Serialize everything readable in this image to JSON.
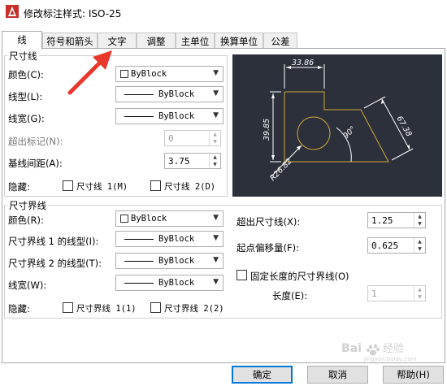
{
  "window": {
    "title": "修改标注样式: ISO-25"
  },
  "tabs": [
    {
      "label": "线",
      "active": true
    },
    {
      "label": "符号和箭头",
      "active": false
    },
    {
      "label": "文字",
      "active": false
    },
    {
      "label": "调整",
      "active": false
    },
    {
      "label": "主单位",
      "active": false
    },
    {
      "label": "换算单位",
      "active": false
    },
    {
      "label": "公差",
      "active": false
    }
  ],
  "dim_lines": {
    "group_label": "尺寸线",
    "color": {
      "label": "颜色(C):",
      "value": "ByBlock"
    },
    "linetype": {
      "label": "线型(L):",
      "value": "ByBlock"
    },
    "lineweight": {
      "label": "线宽(G):",
      "value": "ByBlock"
    },
    "extend_ticks": {
      "label": "超出标记(N):",
      "value": "0"
    },
    "baseline_spacing": {
      "label": "基线间距(A):",
      "value": "3.75"
    },
    "suppress": {
      "label": "隐藏:",
      "dim1": "尺寸线 1(M)",
      "dim2": "尺寸线 2(D)"
    }
  },
  "ext_lines": {
    "group_label": "尺寸界线",
    "color": {
      "label": "颜色(R):",
      "value": "ByBlock"
    },
    "ext1_linetype": {
      "label": "尺寸界线 1 的线型(I):",
      "value": "ByBlock"
    },
    "ext2_linetype": {
      "label": "尺寸界线 2 的线型(T):",
      "value": "ByBlock"
    },
    "lineweight": {
      "label": "线宽(W):",
      "value": "ByBlock"
    },
    "suppress": {
      "label": "隐藏:",
      "ext1": "尺寸界线 1(1)",
      "ext2": "尺寸界线 2(2)"
    },
    "extend_beyond": {
      "label": "超出尺寸线(X):",
      "value": "1.25"
    },
    "offset_origin": {
      "label": "起点偏移量(F):",
      "value": "0.625"
    },
    "fixed_length": {
      "label": "固定长度的尺寸界线(O)"
    },
    "length": {
      "label": "长度(E):",
      "value": "1"
    }
  },
  "preview": {
    "dim_top": "33.86",
    "dim_left": "39.85",
    "dim_right": "67.38",
    "dim_angle": "90°",
    "dim_radius": "R26.82"
  },
  "buttons": {
    "ok": "确定",
    "cancel": "取消",
    "help": "帮助(H)"
  },
  "watermark": {
    "text": "Bai经验",
    "sub": "jingyan.baidu.com"
  },
  "colors": {
    "preview_bg": "#2b303b",
    "preview_geometry": "#d4a93a",
    "preview_dims": "#ffffff",
    "annotation_arrow": "#e8382c"
  }
}
